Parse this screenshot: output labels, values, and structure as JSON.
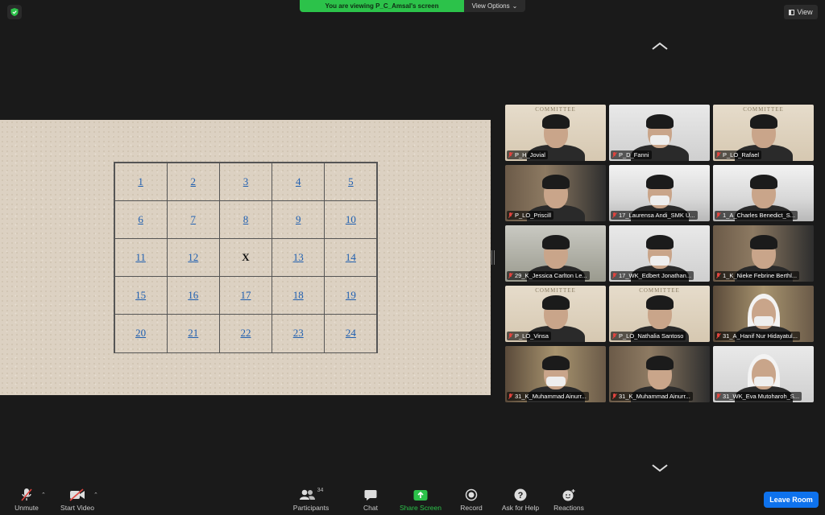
{
  "banner": {
    "viewing": "You are viewing P_C_Amsal's screen",
    "options": "View Options"
  },
  "view_button": "View",
  "shared_screen": {
    "grid": [
      [
        "1",
        "2",
        "3",
        "4",
        "5"
      ],
      [
        "6",
        "7",
        "8",
        "9",
        "10"
      ],
      [
        "11",
        "12",
        "X",
        "13",
        "14"
      ],
      [
        "15",
        "16",
        "17",
        "18",
        "19"
      ],
      [
        "20",
        "21",
        "22",
        "23",
        "24"
      ]
    ]
  },
  "gallery": {
    "tiles": [
      {
        "name": "P_H_Jovial",
        "bg": "committee"
      },
      {
        "name": "P_D_Fanni",
        "bg": "wall"
      },
      {
        "name": "P_LO_Rafael",
        "bg": "committee"
      },
      {
        "name": "P_LO_Priscill",
        "bg": "room"
      },
      {
        "name": "17_Laurensa Andi_SMK U...",
        "bg": "office"
      },
      {
        "name": "1_A_Charles Benedict_S...",
        "bg": "office"
      },
      {
        "name": "29_K_Jessica Carlton Le...",
        "bg": "lab"
      },
      {
        "name": "17_WK_Edbert Jonathan...",
        "bg": "wall"
      },
      {
        "name": "1_K_Nieke Febrine Berthl...",
        "bg": "room"
      },
      {
        "name": "P_LO_Vinsa",
        "bg": "committee"
      },
      {
        "name": "P_LO_Nathalia Santoso",
        "bg": "committee"
      },
      {
        "name": "31_A_Hanif Nur Hidayatul...",
        "bg": "shelf"
      },
      {
        "name": "31_K_Muhammad Ainurr...",
        "bg": "shelf"
      },
      {
        "name": "31_K_Muhammad Ainurr...",
        "bg": "room"
      },
      {
        "name": "31_WK_Eva Mutoharoh_S...",
        "bg": "wall"
      }
    ],
    "committee_text": "COMMITTEE"
  },
  "toolbar": {
    "unmute": "Unmute",
    "start_video": "Start Video",
    "participants": "Participants",
    "participants_count": "34",
    "chat": "Chat",
    "share_screen": "Share Screen",
    "record": "Record",
    "ask_for_help": "Ask for Help",
    "reactions": "Reactions",
    "leave_room": "Leave Room"
  },
  "colors": {
    "green": "#2cc24a",
    "blue": "#0e72ed",
    "muted_red": "#e0443e",
    "link_blue": "#1f5fb0"
  }
}
